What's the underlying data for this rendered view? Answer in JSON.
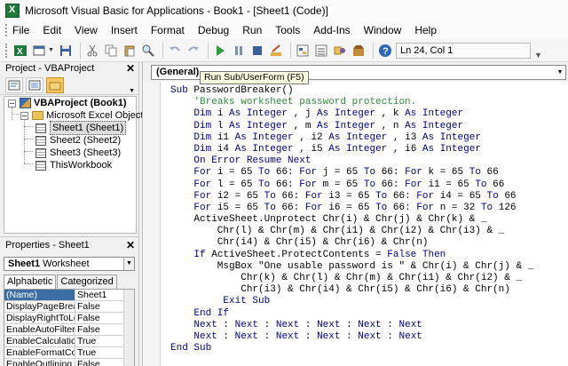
{
  "window": {
    "title": "Microsoft Visual Basic for Applications - Book1 - [Sheet1 (Code)]"
  },
  "menu": [
    "File",
    "Edit",
    "View",
    "Insert",
    "Format",
    "Debug",
    "Run",
    "Tools",
    "Add-Ins",
    "Window",
    "Help"
  ],
  "toolbar": {
    "buttons": [
      "view-excel",
      "insert-userform",
      "save",
      "cut",
      "copy",
      "paste",
      "find",
      "undo",
      "redo",
      "run",
      "break",
      "reset",
      "design-mode",
      "project-explorer",
      "properties-window",
      "object-browser",
      "toolbox",
      "help"
    ],
    "position": "Ln 24, Col 1"
  },
  "project_panel": {
    "title": "Project - VBAProject",
    "tree": {
      "root": "VBAProject (Book1)",
      "folder": "Microsoft Excel Objects",
      "items": [
        "Sheet1 (Sheet1)",
        "Sheet2 (Sheet2)",
        "Sheet3 (Sheet3)",
        "ThisWorkbook"
      ],
      "selected": "Sheet1 (Sheet1)"
    }
  },
  "properties_panel": {
    "title": "Properties - Sheet1",
    "object_name": "Sheet1",
    "object_type": "Worksheet",
    "tabs": [
      "Alphabetic",
      "Categorized"
    ],
    "active_tab": "Alphabetic",
    "rows": [
      {
        "name": "(Name)",
        "value": "Sheet1"
      },
      {
        "name": "DisplayPageBreak",
        "value": "False"
      },
      {
        "name": "DisplayRightToLef",
        "value": "False"
      },
      {
        "name": "EnableAutoFilter",
        "value": "False"
      },
      {
        "name": "EnableCalculation",
        "value": "True"
      },
      {
        "name": "EnableFormatCon",
        "value": "True"
      },
      {
        "name": "EnableOutlining",
        "value": "False"
      }
    ]
  },
  "code_window": {
    "object_combo": "(General)",
    "tooltip": "Run Sub/UserForm (F5)",
    "lines": [
      [
        [
          "kw",
          "Sub"
        ],
        [
          "",
          "PasswordBreaker()"
        ]
      ],
      [
        [
          "",
          "    "
        ],
        [
          "cm",
          "'Breaks worksheet password protection."
        ]
      ],
      [
        [
          "",
          "    "
        ],
        [
          "kw",
          "Dim"
        ],
        [
          "",
          "i "
        ],
        [
          "kw",
          "As Integer"
        ],
        [
          "",
          ", j "
        ],
        [
          "kw",
          "As Integer"
        ],
        [
          "",
          ", k "
        ],
        [
          "kw",
          "As Integer"
        ]
      ],
      [
        [
          "",
          "    "
        ],
        [
          "kw",
          "Dim"
        ],
        [
          "",
          "l "
        ],
        [
          "kw",
          "As Integer"
        ],
        [
          "",
          ", m "
        ],
        [
          "kw",
          "As Integer"
        ],
        [
          "",
          ", n "
        ],
        [
          "kw",
          "As Integer"
        ]
      ],
      [
        [
          "",
          "    "
        ],
        [
          "kw",
          "Dim"
        ],
        [
          "",
          "i1 "
        ],
        [
          "kw",
          "As Integer"
        ],
        [
          "",
          ", i2 "
        ],
        [
          "kw",
          "As Integer"
        ],
        [
          "",
          ", i3 "
        ],
        [
          "kw",
          "As Integer"
        ]
      ],
      [
        [
          "",
          "    "
        ],
        [
          "kw",
          "Dim"
        ],
        [
          "",
          "i4 "
        ],
        [
          "kw",
          "As Integer"
        ],
        [
          "",
          ", i5 "
        ],
        [
          "kw",
          "As Integer"
        ],
        [
          "",
          ", i6 "
        ],
        [
          "kw",
          "As Integer"
        ]
      ],
      [
        [
          "",
          "    "
        ],
        [
          "kw",
          "On Error Resume Next"
        ]
      ],
      [
        [
          "",
          "    "
        ],
        [
          "kw",
          "For"
        ],
        [
          "",
          "i = 65 "
        ],
        [
          "kw",
          "To"
        ],
        [
          "",
          "66: "
        ],
        [
          "kw",
          "For"
        ],
        [
          "",
          "j = 65 "
        ],
        [
          "kw",
          "To"
        ],
        [
          "",
          "66: "
        ],
        [
          "kw",
          "For"
        ],
        [
          "",
          "k = 65 "
        ],
        [
          "kw",
          "To"
        ],
        [
          "",
          "66"
        ]
      ],
      [
        [
          "",
          "    "
        ],
        [
          "kw",
          "For"
        ],
        [
          "",
          "l = 65 "
        ],
        [
          "kw",
          "To"
        ],
        [
          "",
          "66: "
        ],
        [
          "kw",
          "For"
        ],
        [
          "",
          "m = 65 "
        ],
        [
          "kw",
          "To"
        ],
        [
          "",
          "66: "
        ],
        [
          "kw",
          "For"
        ],
        [
          "",
          "i1 = 65 "
        ],
        [
          "kw",
          "To"
        ],
        [
          "",
          "66"
        ]
      ],
      [
        [
          "",
          "    "
        ],
        [
          "kw",
          "For"
        ],
        [
          "",
          "i2 = 65 "
        ],
        [
          "kw",
          "To"
        ],
        [
          "",
          "66: "
        ],
        [
          "kw",
          "For"
        ],
        [
          "",
          "i3 = 65 "
        ],
        [
          "kw",
          "To"
        ],
        [
          "",
          "66: "
        ],
        [
          "kw",
          "For"
        ],
        [
          "",
          "i4 = 65 "
        ],
        [
          "kw",
          "To"
        ],
        [
          "",
          "66"
        ]
      ],
      [
        [
          "",
          "    "
        ],
        [
          "kw",
          "For"
        ],
        [
          "",
          "i5 = 65 "
        ],
        [
          "kw",
          "To"
        ],
        [
          "",
          "66: "
        ],
        [
          "kw",
          "For"
        ],
        [
          "",
          "i6 = 65 "
        ],
        [
          "kw",
          "To"
        ],
        [
          "",
          "66: "
        ],
        [
          "kw",
          "For"
        ],
        [
          "",
          "n = 32 "
        ],
        [
          "kw",
          "To"
        ],
        [
          "",
          "126"
        ]
      ],
      [
        [
          "",
          "    ActiveSheet.Unprotect Chr(i) & Chr(j) & Chr(k) & _"
        ]
      ],
      [
        [
          "",
          "        Chr(l) & Chr(m) & Chr(i1) & Chr(i2) & Chr(i3) & _"
        ]
      ],
      [
        [
          "",
          "        Chr(i4) & Chr(i5) & Chr(i6) & Chr(n)"
        ]
      ],
      [
        [
          "",
          "    "
        ],
        [
          "kw",
          "If"
        ],
        [
          "",
          "ActiveSheet.ProtectContents = "
        ],
        [
          "kw",
          "False Then"
        ]
      ],
      [
        [
          "",
          "        MsgBox \"One usable password is \" & Chr(i) & Chr(j) & _"
        ]
      ],
      [
        [
          "",
          "            Chr(k) & Chr(l) & Chr(m) & Chr(i1) & Chr(i2) & _"
        ]
      ],
      [
        [
          "",
          "            Chr(i3) & Chr(i4) & Chr(i5) & Chr(i6) & Chr(n)"
        ]
      ],
      [
        [
          "",
          "         "
        ],
        [
          "kw",
          "Exit Sub"
        ]
      ],
      [
        [
          "",
          "    "
        ],
        [
          "kw",
          "End If"
        ]
      ],
      [
        [
          "",
          "    "
        ],
        [
          "kw",
          "Next"
        ],
        [
          "",
          ": "
        ],
        [
          "kw",
          "Next"
        ],
        [
          "",
          ": "
        ],
        [
          "kw",
          "Next"
        ],
        [
          "",
          ": "
        ],
        [
          "kw",
          "Next"
        ],
        [
          "",
          ": "
        ],
        [
          "kw",
          "Next"
        ],
        [
          "",
          ": "
        ],
        [
          "kw",
          "Next"
        ]
      ],
      [
        [
          "",
          "    "
        ],
        [
          "kw",
          "Next"
        ],
        [
          "",
          ": "
        ],
        [
          "kw",
          "Next"
        ],
        [
          "",
          ": "
        ],
        [
          "kw",
          "Next"
        ],
        [
          "",
          ": "
        ],
        [
          "kw",
          "Next"
        ],
        [
          "",
          ": "
        ],
        [
          "kw",
          "Next"
        ],
        [
          "",
          ": "
        ],
        [
          "kw",
          "Next"
        ]
      ],
      [
        [
          "kw",
          "End Sub"
        ]
      ]
    ]
  }
}
